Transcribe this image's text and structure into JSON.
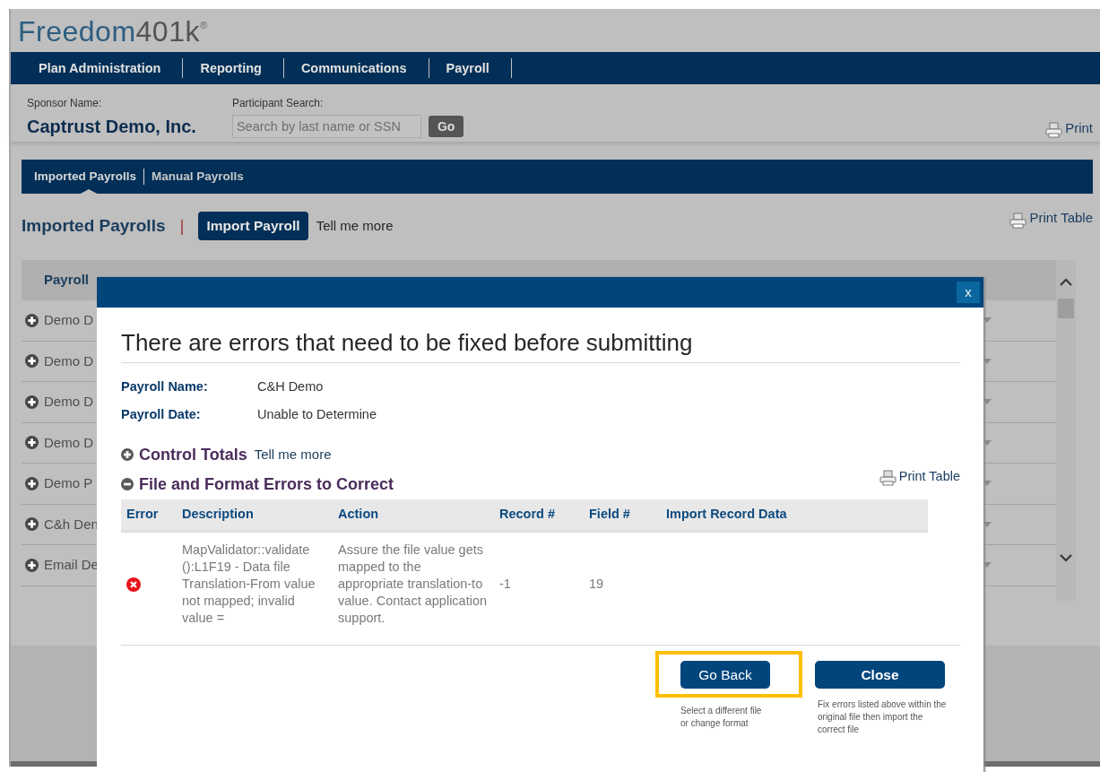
{
  "logo": {
    "primary": "Freedom",
    "secondary": "401k",
    "registered": "®"
  },
  "nav": [
    {
      "label": "Plan Administration"
    },
    {
      "label": "Reporting"
    },
    {
      "label": "Communications"
    },
    {
      "label": "Payroll"
    }
  ],
  "sponsor": {
    "label": "Sponsor Name:",
    "value": "Captrust Demo, Inc."
  },
  "participant_search": {
    "label": "Participant Search:",
    "placeholder": "Search by last name or SSN",
    "button": "Go"
  },
  "print_link": "Print",
  "subtabs": [
    {
      "label": "Imported Payrolls",
      "selected": true
    },
    {
      "label": "Manual Payrolls",
      "selected": false
    }
  ],
  "section": {
    "title": "Imported Payrolls",
    "separator": "|",
    "import_button": "Import Payroll",
    "help_link": "Tell me more",
    "print_link": "Print Table"
  },
  "payroll_table": {
    "columns": [
      "Payroll"
    ],
    "rows": [
      {
        "name": "Demo D"
      },
      {
        "name": "Demo D"
      },
      {
        "name": "Demo D"
      },
      {
        "name": "Demo D"
      },
      {
        "name": "Demo P"
      },
      {
        "name": "C&h Den"
      },
      {
        "name": "Email De"
      }
    ]
  },
  "modal": {
    "close_button": "x",
    "title": "There are errors that need to be fixed before submitting",
    "details": [
      {
        "label": "Payroll Name:",
        "value": "C&H Demo"
      },
      {
        "label": "Payroll Date:",
        "value": "Unable to Determine"
      }
    ],
    "sections": [
      {
        "title": "Control Totals",
        "expanded": false,
        "help_link": "Tell me more"
      },
      {
        "title": "File and Format Errors to Correct",
        "expanded": true,
        "print_link": "Print Table"
      }
    ],
    "errors_table": {
      "columns": [
        "Error",
        "Description",
        "Action",
        "Record #",
        "Field #",
        "Import Record Data"
      ],
      "rows": [
        {
          "kind": "error",
          "description": "MapValidator::validate ():L1F19 - Data file Translation-From value not mapped; invalid value =",
          "action": "Assure the file value gets mapped to the appropriate translation-to value. Contact application support.",
          "record": "-1",
          "field": "19"
        }
      ]
    },
    "actions": [
      {
        "label": "Go Back",
        "kind": "normal",
        "highlighted": true,
        "hint": "Select a different file or change format"
      },
      {
        "label": "Close",
        "kind": "emphasis",
        "highlighted": false,
        "hint": "Fix errors listed above within the original file then import the correct file"
      }
    ]
  }
}
